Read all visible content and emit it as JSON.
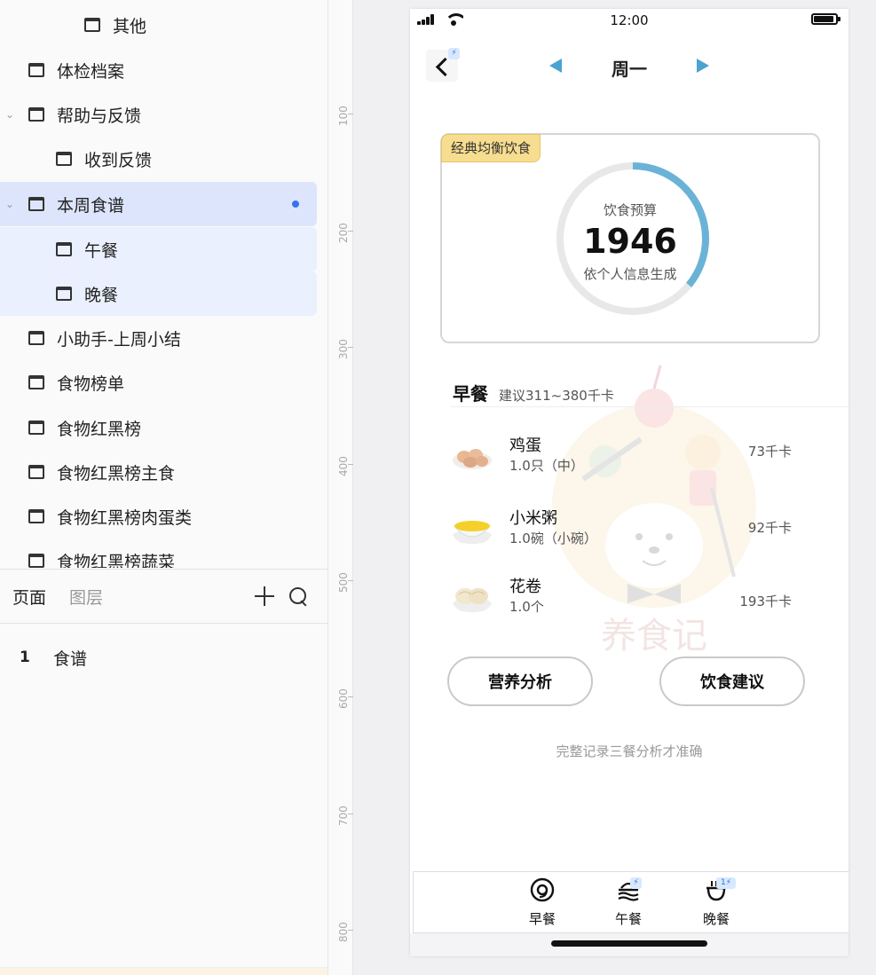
{
  "layer_tree": {
    "items": [
      {
        "label": "其他",
        "indent": 2,
        "chevron": false
      },
      {
        "label": "体检档案",
        "indent": 1,
        "chevron": false
      },
      {
        "label": "帮助与反馈",
        "indent": 1,
        "chevron": true
      },
      {
        "label": "收到反馈",
        "indent": 2,
        "chevron": false
      },
      {
        "label": "本周食谱",
        "indent": 1,
        "chevron": true,
        "selected": true
      },
      {
        "label": "午餐",
        "indent": 2,
        "chevron": false
      },
      {
        "label": "晚餐",
        "indent": 2,
        "chevron": false
      },
      {
        "label": "小助手-上周小结",
        "indent": 1,
        "chevron": false
      },
      {
        "label": "食物榜单",
        "indent": 1,
        "chevron": false
      },
      {
        "label": "食物红黑榜",
        "indent": 1,
        "chevron": false
      },
      {
        "label": "食物红黑榜主食",
        "indent": 1,
        "chevron": false
      },
      {
        "label": "食物红黑榜肉蛋类",
        "indent": 1,
        "chevron": false
      },
      {
        "label": "食物红黑榜蔬菜",
        "indent": 1,
        "chevron": false
      }
    ]
  },
  "pages_panel": {
    "tab_pages": "页面",
    "tab_layers": "图层",
    "pages": [
      {
        "num": "1",
        "name": "食谱"
      }
    ]
  },
  "ruler": {
    "ticks": [
      "100",
      "200",
      "300",
      "400",
      "500",
      "600",
      "700",
      "800"
    ]
  },
  "phone": {
    "status_time": "12:00",
    "nav": {
      "day": "周一"
    },
    "budget": {
      "tag": "经典均衡饮食",
      "label": "饮食预算",
      "value": "1946",
      "note": "依个人信息生成",
      "progress": 0.36,
      "ring_color": "#6ab3d6",
      "track_color": "#e8e8e8"
    },
    "breakfast": {
      "title": "早餐",
      "suggestion": "建议311~380千卡",
      "foods": [
        {
          "name": "鸡蛋",
          "qty": "1.0只（中）",
          "cal": "73千卡",
          "icon": "egg-icon"
        },
        {
          "name": "小米粥",
          "qty": "1.0碗（小碗）",
          "cal": "92千卡",
          "icon": "porridge-icon"
        },
        {
          "name": "花卷",
          "qty": "1.0个",
          "cal": "193千卡",
          "icon": "steamed-roll-icon"
        }
      ]
    },
    "actions": {
      "nutrition": "营养分析",
      "advice": "饮食建议"
    },
    "hint": "完整记录三餐分析才准确",
    "watermark_text": "养食记",
    "tabbar": [
      {
        "label": "早餐",
        "icon": "breakfast-icon"
      },
      {
        "label": "午餐",
        "icon": "lunch-icon"
      },
      {
        "label": "晚餐",
        "icon": "dinner-icon"
      }
    ]
  }
}
